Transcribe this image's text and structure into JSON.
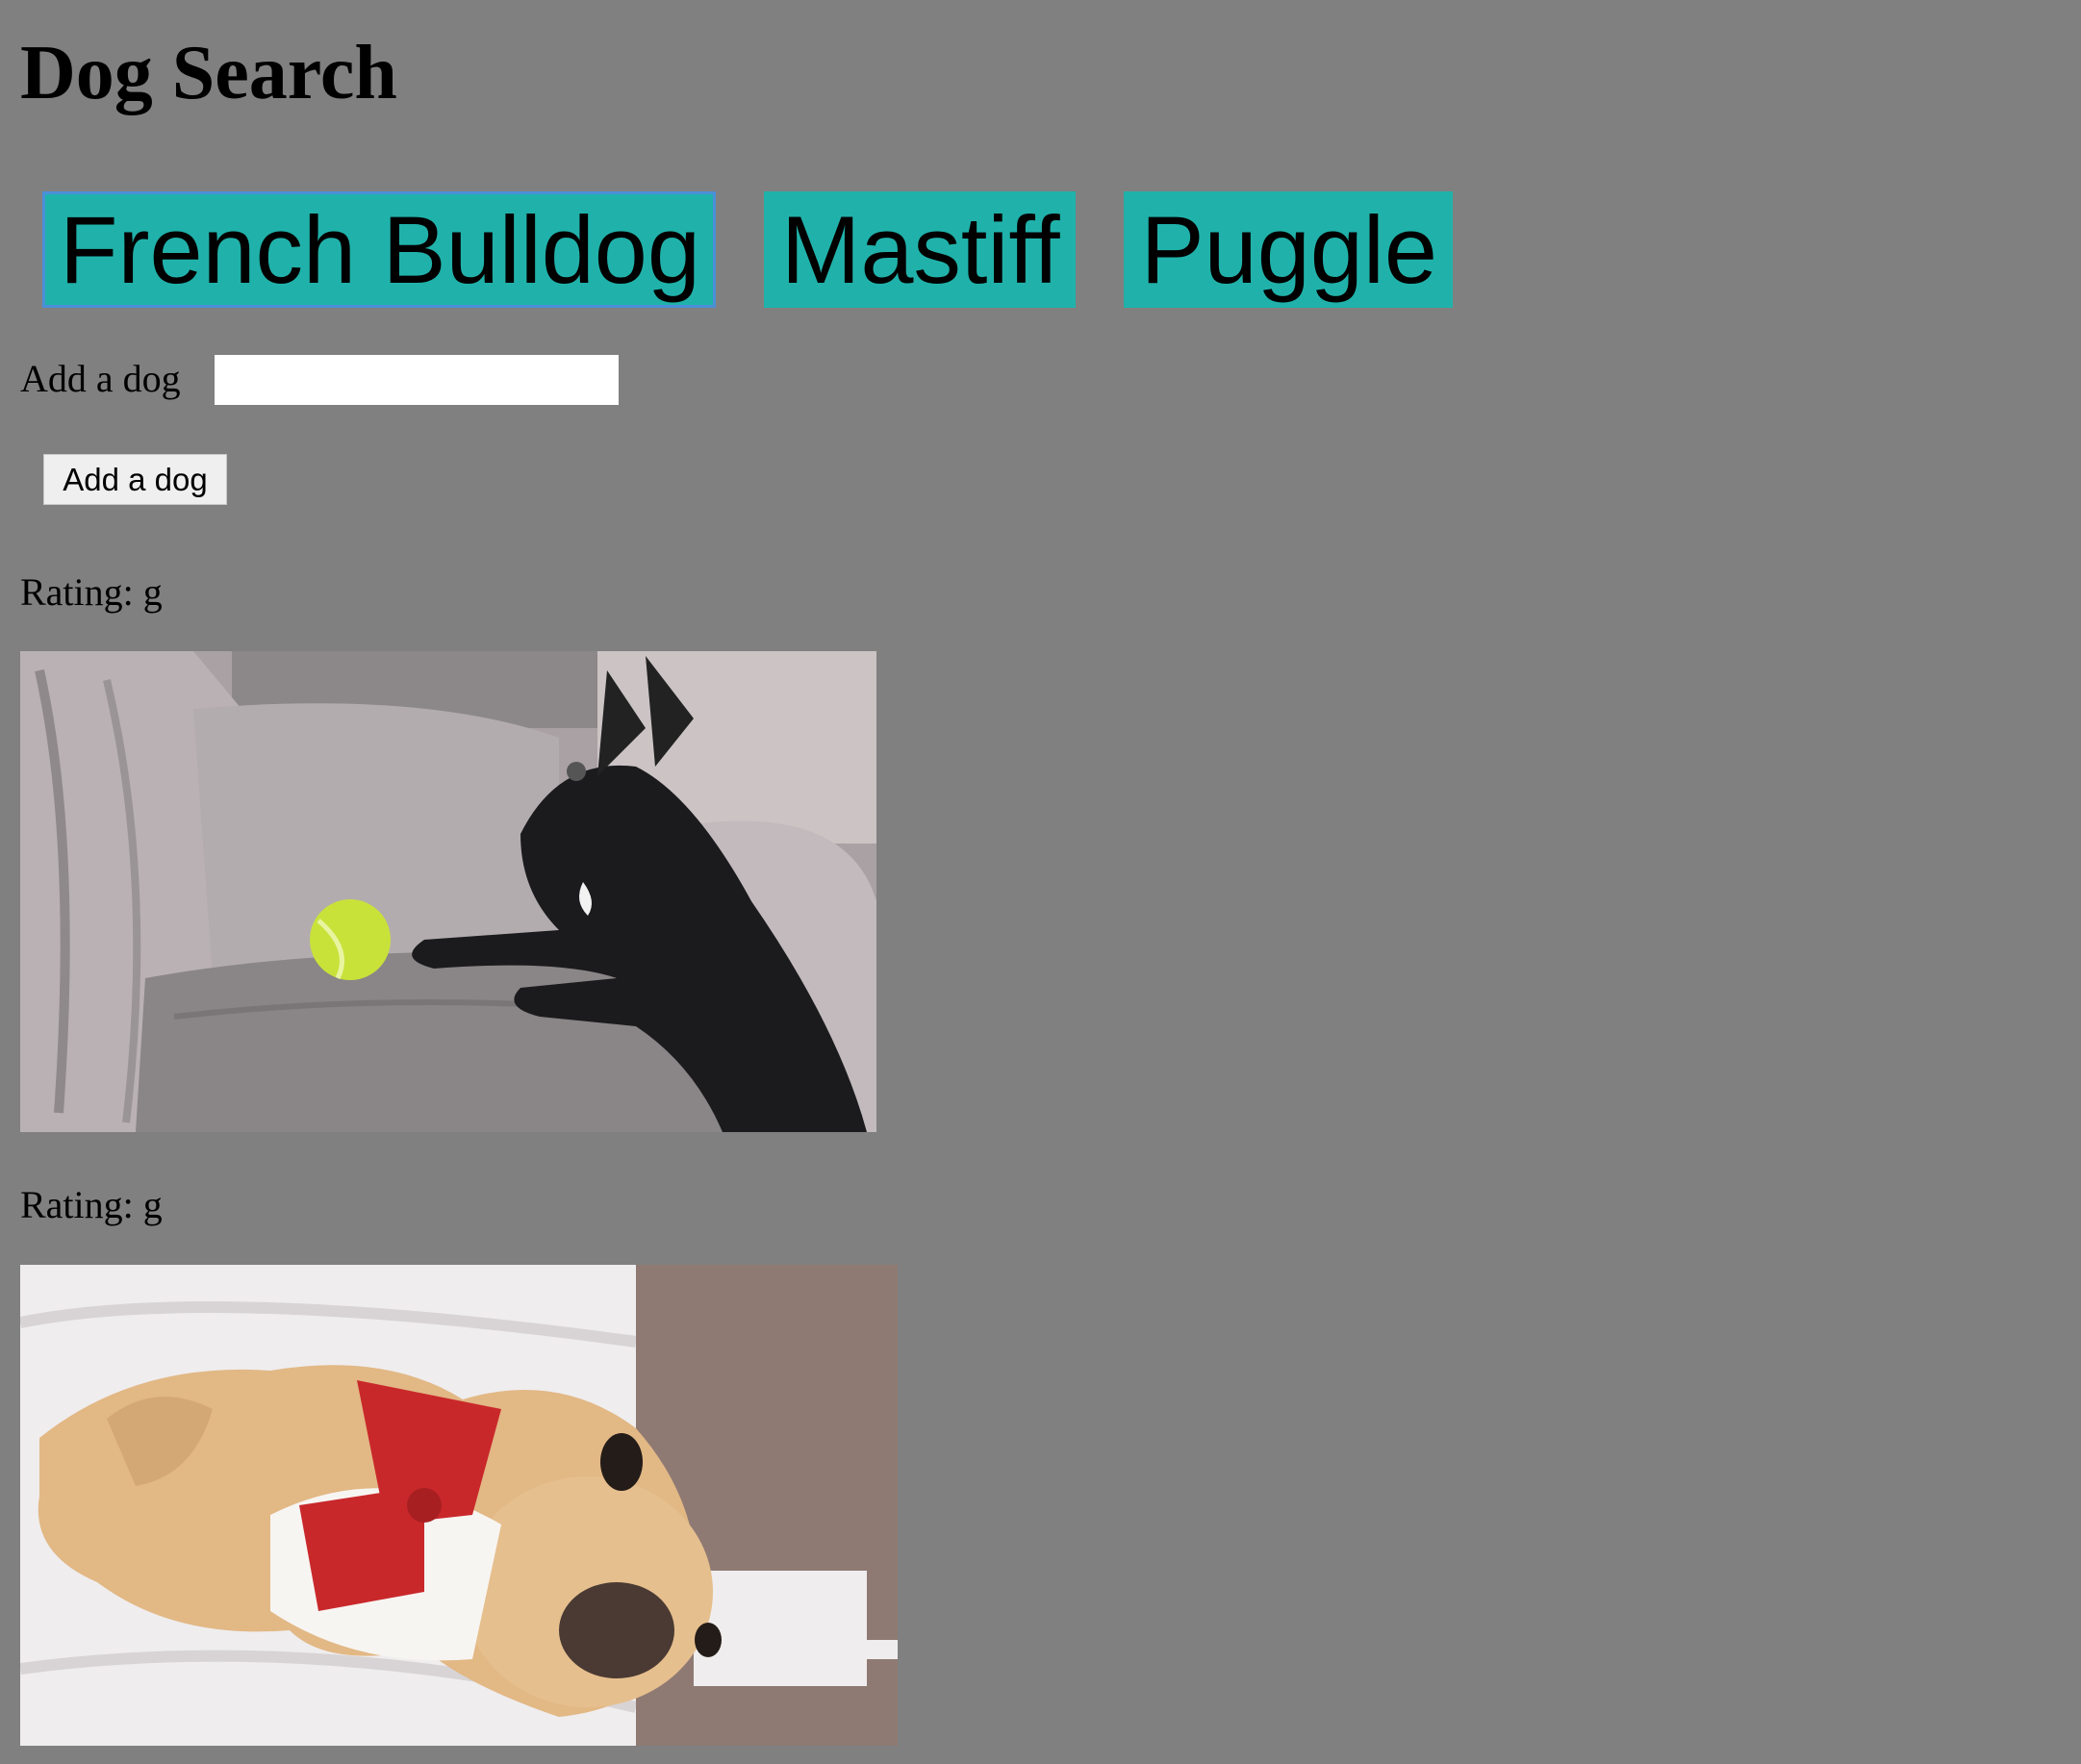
{
  "page": {
    "title": "Dog Search"
  },
  "breeds": [
    {
      "label": "French Bulldog"
    },
    {
      "label": "Mastiff"
    },
    {
      "label": "Puggle"
    }
  ],
  "add_form": {
    "label": "Add a dog",
    "input_value": "",
    "button_label": "Add a dog"
  },
  "results": [
    {
      "rating_label": "Rating: g",
      "image": "french-bulldog-sofa-tennis-ball-gif"
    },
    {
      "rating_label": "Rating: g",
      "image": "puppy-red-bowtie-bed-gif"
    }
  ],
  "colors": {
    "background": "#808080",
    "breed_button": "#20b2aa",
    "focus_ring": "#4a90d9"
  }
}
